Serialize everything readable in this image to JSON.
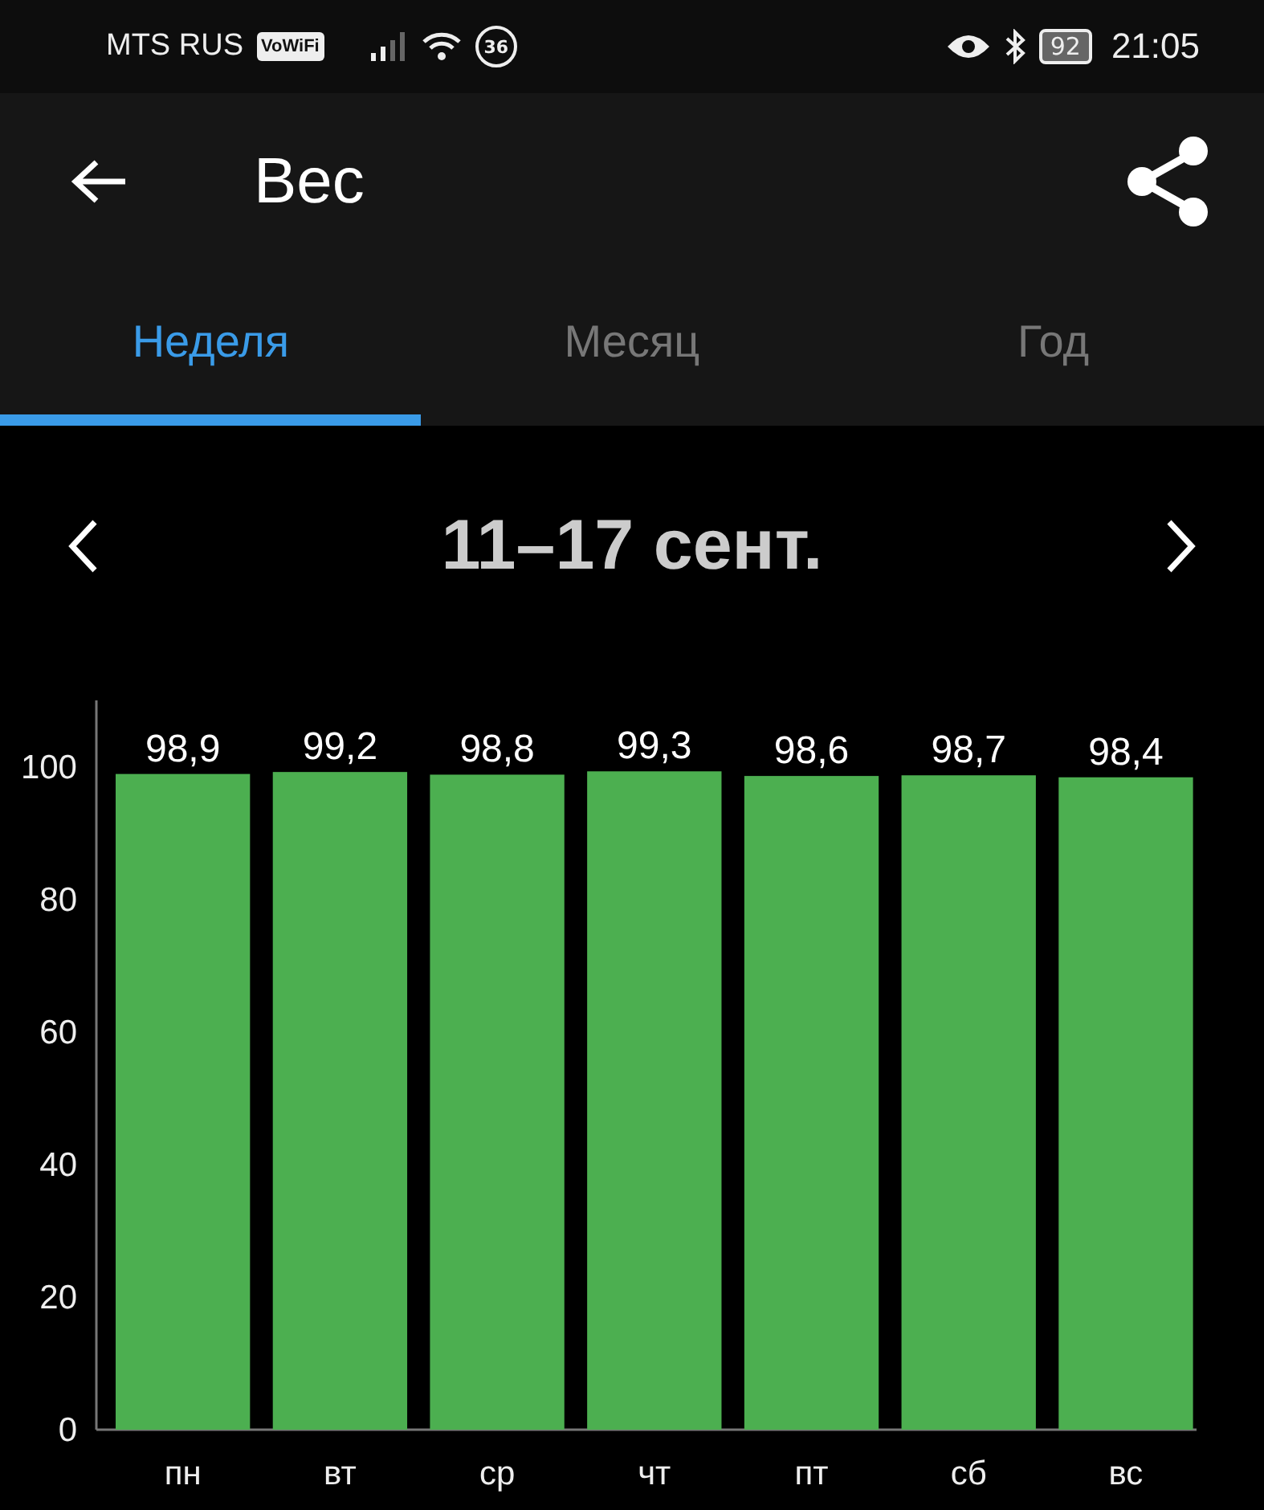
{
  "status_bar": {
    "carrier": "MTS RUS",
    "vowifi_badge": "VoWiFi",
    "data_badge": "36",
    "battery": "92",
    "time": "21:05"
  },
  "header": {
    "title": "Вес"
  },
  "tabs": [
    {
      "label": "Неделя",
      "selected": true
    },
    {
      "label": "Месяц",
      "selected": false
    },
    {
      "label": "Год",
      "selected": false
    }
  ],
  "period": {
    "label": "11–17 сент."
  },
  "chart": {
    "chart_data": {
      "type": "bar",
      "categories": [
        "пн",
        "вт",
        "ср",
        "чт",
        "пт",
        "сб",
        "вс"
      ],
      "values": [
        98.9,
        99.2,
        98.8,
        99.3,
        98.6,
        98.7,
        98.4
      ],
      "value_labels": [
        "98,9",
        "99,2",
        "98,8",
        "99,3",
        "98,6",
        "98,7",
        "98,4"
      ],
      "ylim": [
        0,
        110
      ],
      "yticks": [
        0,
        20,
        40,
        60,
        80,
        100
      ]
    }
  }
}
